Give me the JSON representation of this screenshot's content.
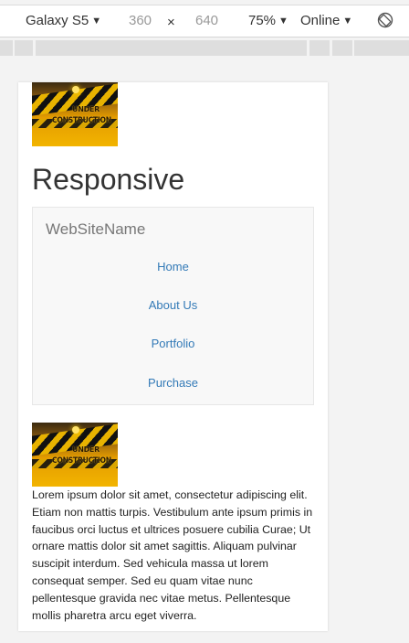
{
  "devtools": {
    "device": "Galaxy S5",
    "width": "360",
    "times": "×",
    "height": "640",
    "zoom": "75%",
    "network": "Online",
    "caret": "▼",
    "rotate_icon": "rotate-icon"
  },
  "page": {
    "image_alt": "under-construction-image",
    "logo_text_line1": "UNDER",
    "logo_text_line2": "CONSTRUCTION",
    "title": "Responsive",
    "navbar": {
      "brand": "WebSiteName",
      "items": [
        "Home",
        "About Us",
        "Portfolio",
        "Purchase"
      ]
    },
    "body_text": "Lorem ipsum dolor sit amet, consectetur adipiscing elit. Etiam non mattis turpis. Vestibulum ante ipsum primis in faucibus orci luctus et ultrices posuere cubilia Curae; Ut ornare mattis dolor sit amet sagittis. Aliquam pulvinar suscipit interdum. Sed vehicula massa ut lorem consequat semper. Sed eu quam vitae nunc pellentesque gravida nec vitae metus. Pellentesque mollis pharetra arcu eget viverra."
  },
  "colors": {
    "link": "#337ab7",
    "nav_bg": "#f8f8f8",
    "brand": "#777777"
  }
}
